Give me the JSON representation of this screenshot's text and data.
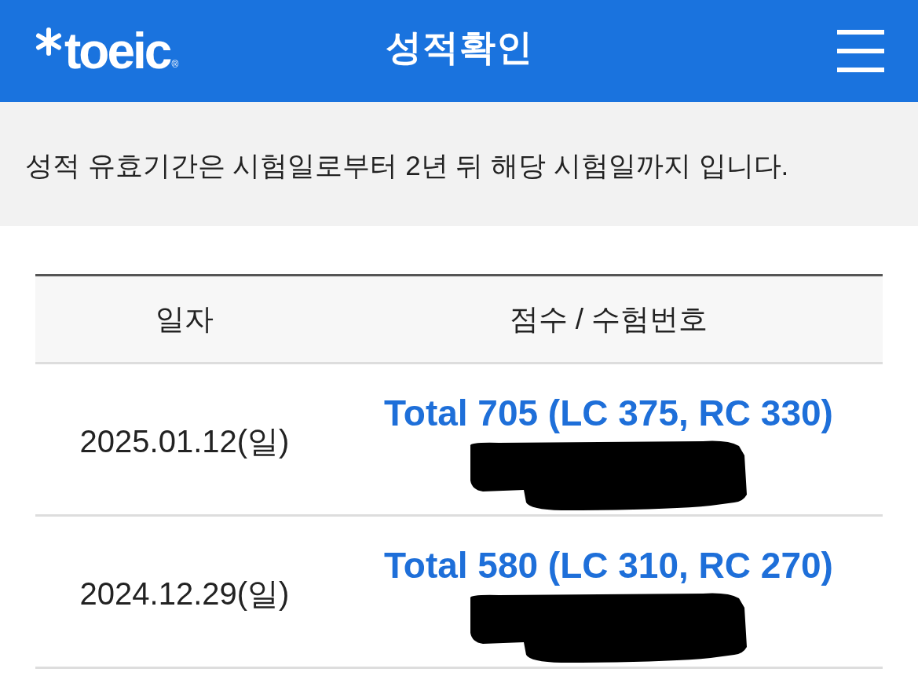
{
  "header": {
    "logo": {
      "wordmark": "toeic",
      "registered_mark": "®"
    },
    "title": "성적확인"
  },
  "notice": "성적 유효기간은 시험일로부터 2년 뒤 해당 시험일까지 입니다.",
  "table": {
    "columns": [
      "일자",
      "점수 / 수험번호"
    ],
    "rows": [
      {
        "date": "2025.01.12(일)",
        "score": "Total 705 (LC 375, RC 330)",
        "exam_number_redacted": true
      },
      {
        "date": "2024.12.29(일)",
        "score": "Total 580 (LC 310, RC 270)",
        "exam_number_redacted": true
      }
    ]
  }
}
